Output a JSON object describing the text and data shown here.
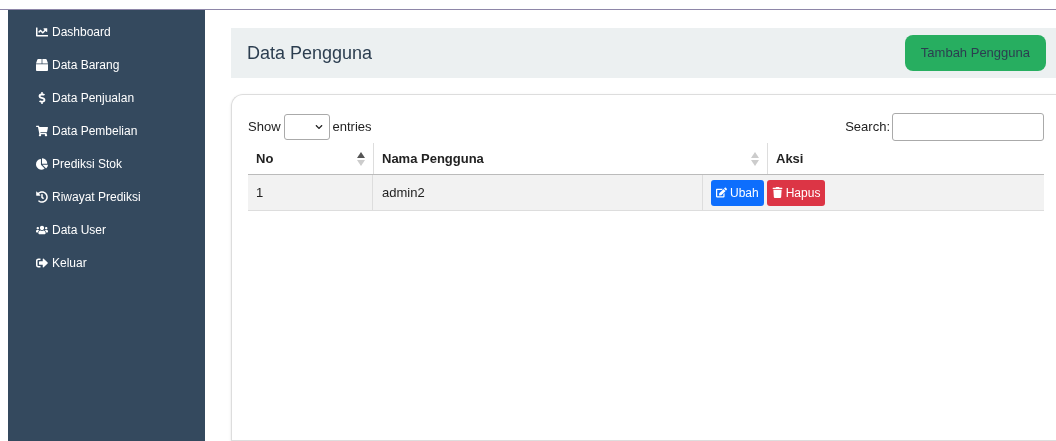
{
  "sidebar": {
    "items": [
      {
        "label": "Dashboard"
      },
      {
        "label": "Data Barang"
      },
      {
        "label": "Data Penjualan"
      },
      {
        "label": "Data Pembelian"
      },
      {
        "label": "Prediksi Stok"
      },
      {
        "label": "Riwayat Prediksi"
      },
      {
        "label": "Data User"
      },
      {
        "label": "Keluar"
      }
    ]
  },
  "header": {
    "title": "Data Pengguna",
    "button": "Tambah Pengguna"
  },
  "table": {
    "show_label": "Show",
    "entries_label": "entries",
    "search_label": "Search:",
    "columns": [
      {
        "label": "No",
        "sorted": true
      },
      {
        "label": "Nama Pengguna",
        "sorted": false
      },
      {
        "label": "Aksi"
      }
    ],
    "rows": [
      {
        "no": "1",
        "name": "admin2",
        "actions": [
          {
            "label": "Ubah",
            "kind": "edit"
          },
          {
            "label": "Hapus",
            "kind": "delete"
          }
        ]
      }
    ]
  }
}
